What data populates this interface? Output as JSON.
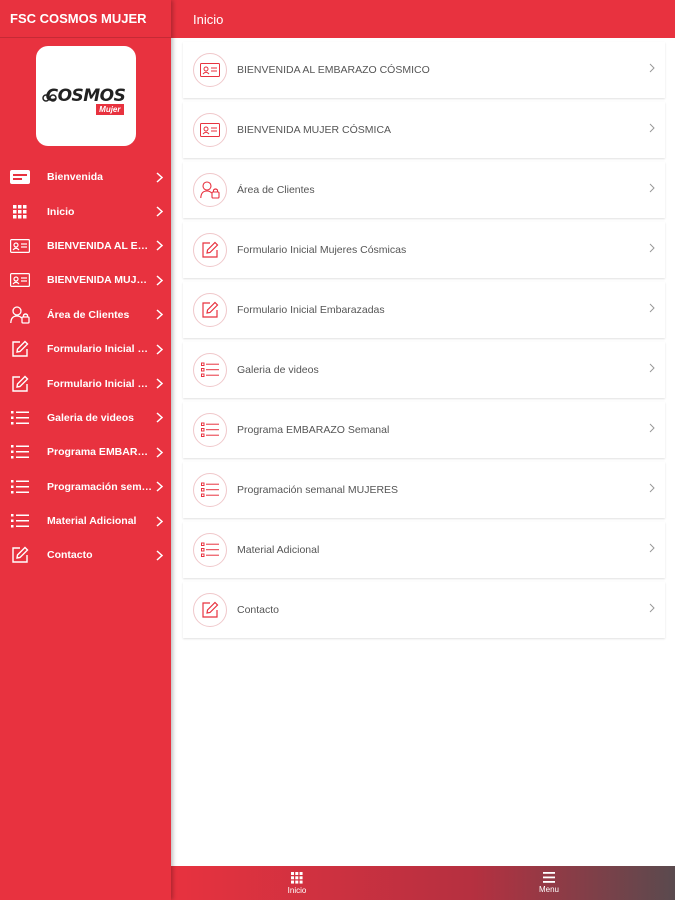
{
  "app": {
    "title": "FSC COSMOS MUJER",
    "logo_text": "COSMOS",
    "logo_sub": "Mujer"
  },
  "colors": {
    "accent": "#e8323f",
    "icon_stroke": "#e8323f",
    "side_icon": "#ffffff"
  },
  "topbar": {
    "title": "Inicio"
  },
  "sidebar": {
    "items": [
      {
        "label": "Bienvenida",
        "icon": "welcome-badge-icon"
      },
      {
        "label": "Inicio",
        "icon": "grid-icon"
      },
      {
        "label": "BIENVENIDA AL EMBARAZO CÓSMICO",
        "icon": "id-card-icon"
      },
      {
        "label": "BIENVENIDA MUJER CÓSMICA",
        "icon": "id-card-icon"
      },
      {
        "label": "Área de Clientes",
        "icon": "user-lock-icon"
      },
      {
        "label": "Formulario Inicial Mujeres Cósmicas",
        "icon": "edit-icon"
      },
      {
        "label": "Formulario Inicial Embarazadas",
        "icon": "edit-icon"
      },
      {
        "label": "Galeria de videos",
        "icon": "list-icon"
      },
      {
        "label": "Programa EMBARAZO Semanal",
        "icon": "list-icon"
      },
      {
        "label": "Programación semanal MUJERES",
        "icon": "list-icon"
      },
      {
        "label": "Material Adicional",
        "icon": "list-icon"
      },
      {
        "label": "Contacto",
        "icon": "edit-icon"
      }
    ]
  },
  "main": {
    "items": [
      {
        "label": "BIENVENIDA AL EMBARAZO CÓSMICO",
        "icon": "id-card-icon"
      },
      {
        "label": "BIENVENIDA MUJER CÓSMICA",
        "icon": "id-card-icon"
      },
      {
        "label": "Área de Clientes",
        "icon": "user-lock-icon"
      },
      {
        "label": "Formulario Inicial Mujeres Cósmicas",
        "icon": "edit-icon"
      },
      {
        "label": "Formulario Inicial Embarazadas",
        "icon": "edit-icon"
      },
      {
        "label": "Galeria de videos",
        "icon": "list-icon"
      },
      {
        "label": "Programa EMBARAZO Semanal",
        "icon": "list-icon"
      },
      {
        "label": "Programación semanal MUJERES",
        "icon": "list-icon"
      },
      {
        "label": "Material Adicional",
        "icon": "list-icon"
      },
      {
        "label": "Contacto",
        "icon": "edit-icon"
      }
    ]
  },
  "bottombar": {
    "tabs": [
      {
        "label": "Inicio",
        "icon": "grid-icon"
      },
      {
        "label": "Menu",
        "icon": "hamburger-icon"
      }
    ]
  }
}
